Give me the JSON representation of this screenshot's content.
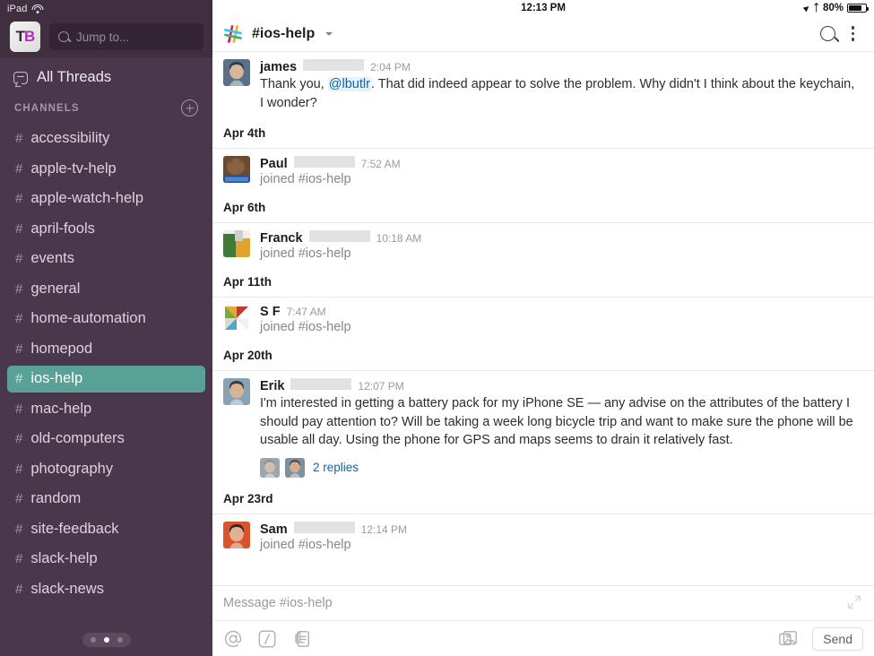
{
  "status_bar": {
    "device_label": "iPad",
    "wifi_icon": "wifi-icon",
    "time": "12:13 PM",
    "location_icon": "location-arrow-icon",
    "bluetooth_icon": "bluetooth-icon",
    "battery_percent": "80%",
    "battery_icon": "battery-icon"
  },
  "sidebar": {
    "team_logo": {
      "letter_1": "T",
      "letter_2": "B"
    },
    "search": {
      "placeholder": "Jump to...",
      "icon": "search-icon"
    },
    "all_threads": {
      "label": "All Threads",
      "icon": "threads-icon"
    },
    "channels_header": {
      "label": "CHANNELS",
      "add_icon": "plus-circle-icon"
    },
    "channels": [
      {
        "hash": "#",
        "name": "accessibility",
        "active": false
      },
      {
        "hash": "#",
        "name": "apple-tv-help",
        "active": false
      },
      {
        "hash": "#",
        "name": "apple-watch-help",
        "active": false
      },
      {
        "hash": "#",
        "name": "april-fools",
        "active": false
      },
      {
        "hash": "#",
        "name": "events",
        "active": false
      },
      {
        "hash": "#",
        "name": "general",
        "active": false
      },
      {
        "hash": "#",
        "name": "home-automation",
        "active": false
      },
      {
        "hash": "#",
        "name": "homepod",
        "active": false
      },
      {
        "hash": "#",
        "name": "ios-help",
        "active": true
      },
      {
        "hash": "#",
        "name": "mac-help",
        "active": false
      },
      {
        "hash": "#",
        "name": "old-computers",
        "active": false
      },
      {
        "hash": "#",
        "name": "photography",
        "active": false
      },
      {
        "hash": "#",
        "name": "random",
        "active": false
      },
      {
        "hash": "#",
        "name": "site-feedback",
        "active": false
      },
      {
        "hash": "#",
        "name": "slack-help",
        "active": false
      },
      {
        "hash": "#",
        "name": "slack-news",
        "active": false
      }
    ],
    "page_dots": {
      "count": 3,
      "active_index": 1
    },
    "colors": {
      "background": "#4b374b",
      "active_channel": "#58a194",
      "top_bar": "#40303f"
    }
  },
  "channel_header": {
    "logo_icon": "slack-logo-icon",
    "title": "#ios-help",
    "caret_icon": "chevron-down-icon",
    "search_icon": "search-icon",
    "menu_icon": "kebab-menu-icon"
  },
  "messages": [
    {
      "type": "message",
      "author": "james",
      "time": "2:04 PM",
      "redacted": true,
      "text_before": "Thank you, ",
      "mention": "@lbutlr",
      "text_after": ". That did indeed appear to solve the problem. Why didn't I think about the keychain, I wonder?",
      "avatar": "avatar-james"
    },
    {
      "type": "divider",
      "label": "Apr 4th"
    },
    {
      "type": "join",
      "author": "Paul",
      "time": "7:52 AM",
      "redacted": true,
      "text": "joined #ios-help",
      "avatar": "avatar-paul"
    },
    {
      "type": "divider",
      "label": "Apr 6th"
    },
    {
      "type": "join",
      "author": "Franck",
      "time": "10:18 AM",
      "redacted": true,
      "text": "joined #ios-help",
      "avatar": "avatar-franck"
    },
    {
      "type": "divider",
      "label": "Apr 11th"
    },
    {
      "type": "join",
      "author": "S F",
      "time": "7:47 AM",
      "redacted": false,
      "text": "joined #ios-help",
      "avatar": "avatar-sf"
    },
    {
      "type": "divider",
      "label": "Apr 20th"
    },
    {
      "type": "message",
      "author": "Erik",
      "time": "12:07 PM",
      "redacted": true,
      "text": "I'm interested in getting a battery pack for my iPhone SE — any advise on the attributes of the battery I should pay attention to? Will be taking a week long bicycle trip and want to make sure the phone will be usable all day. Using the phone for GPS and maps seems to drain it relatively fast.",
      "replies_label": "2 replies",
      "avatar": "avatar-erik"
    },
    {
      "type": "divider",
      "label": "Apr 23rd"
    },
    {
      "type": "join",
      "author": "Sam",
      "time": "12:14 PM",
      "redacted": true,
      "text": "joined #ios-help",
      "avatar": "avatar-sam"
    }
  ],
  "composer": {
    "placeholder": "Message #ios-help",
    "expand_icon": "expand-icon",
    "mention_icon": "at-icon",
    "command_icon": "slash-command-icon",
    "attachment_icon": "attachment-icon",
    "photo_icon": "photo-icon",
    "send_label": "Send"
  }
}
